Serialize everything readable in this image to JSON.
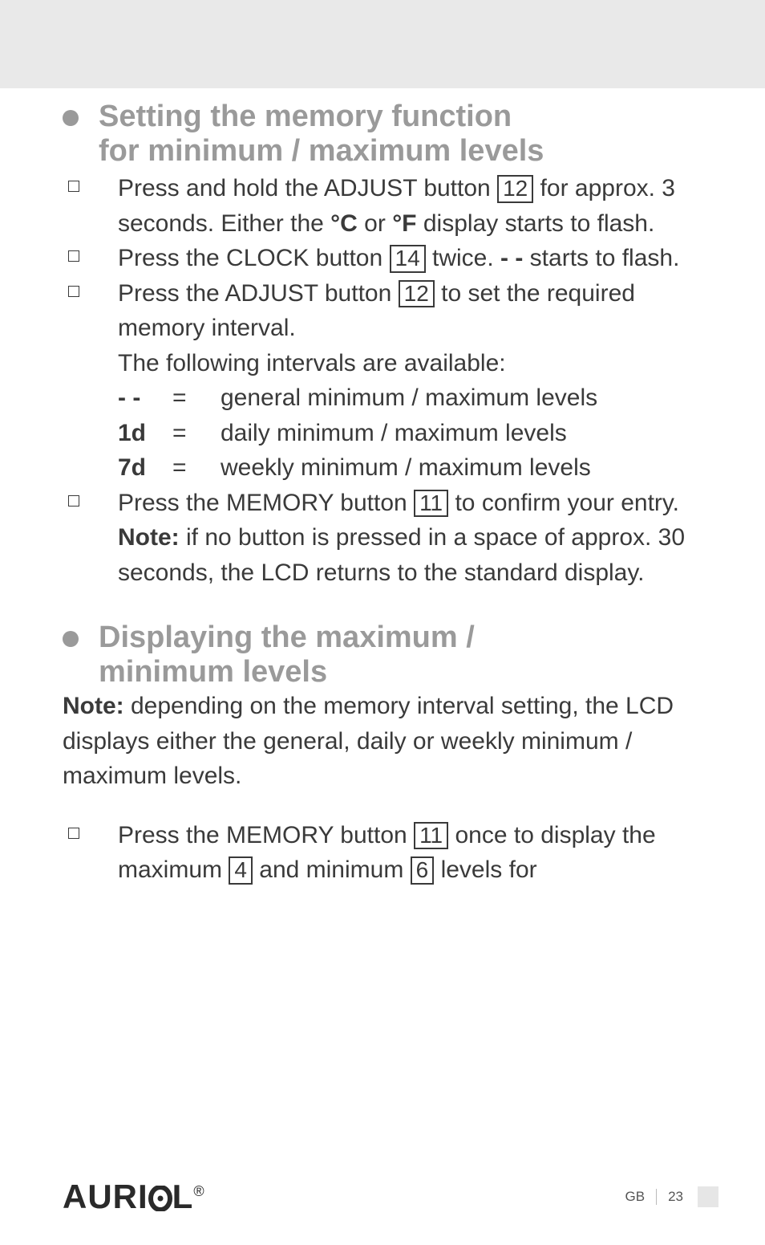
{
  "section1": {
    "heading_l1": "Setting the memory function",
    "heading_l2": "for minimum / maximum levels",
    "items": [
      {
        "pre1": "Press and hold the ADJUST button ",
        "ref1": "12",
        "post1": " for approx. 3 seconds. Either the ",
        "bold1": "°C",
        "mid1": " or ",
        "bold2": "°F",
        "post2": " display starts to flash."
      },
      {
        "pre1": "Press the CLOCK button ",
        "ref1": "14",
        "post1": " twice. ",
        "bold1": "- -",
        "post2": " starts to flash."
      },
      {
        "pre1": "Press the ADJUST button ",
        "ref1": "12",
        "post1": " to set the required memory interval.",
        "line2": "The following intervals are available:"
      },
      {
        "pre1": "Press the MEMORY button ",
        "ref1": "11",
        "post1": " to confirm your entry.",
        "note_label": "Note:",
        "note_body": " if no button is pressed in a space of approx. 30 seconds, the LCD returns to the standard display."
      }
    ],
    "intervals": [
      {
        "sym": "- -",
        "eq": "=",
        "desc": "general minimum / maximum levels"
      },
      {
        "sym": "1d",
        "eq": "=",
        "desc": "daily minimum / maximum levels"
      },
      {
        "sym": "7d",
        "eq": "=",
        "desc": "weekly minimum / maximum levels"
      }
    ]
  },
  "section2": {
    "heading_l1": "Displaying the maximum /",
    "heading_l2": "minimum levels",
    "note_label": "Note:",
    "note_body": " depending on the memory interval setting, the LCD displays either the general, daily or weekly minimum / maximum levels.",
    "item1": {
      "pre1": "Press the MEMORY button ",
      "ref1": "11",
      "mid1": " once to display the maximum ",
      "ref2": "4",
      "mid2": " and minimum ",
      "ref3": "6",
      "post1": " levels for"
    }
  },
  "footer": {
    "logo": "AURI",
    "logo_o": "O",
    "logo_l": "L",
    "reg": "®",
    "gb": "GB",
    "page": "23"
  }
}
